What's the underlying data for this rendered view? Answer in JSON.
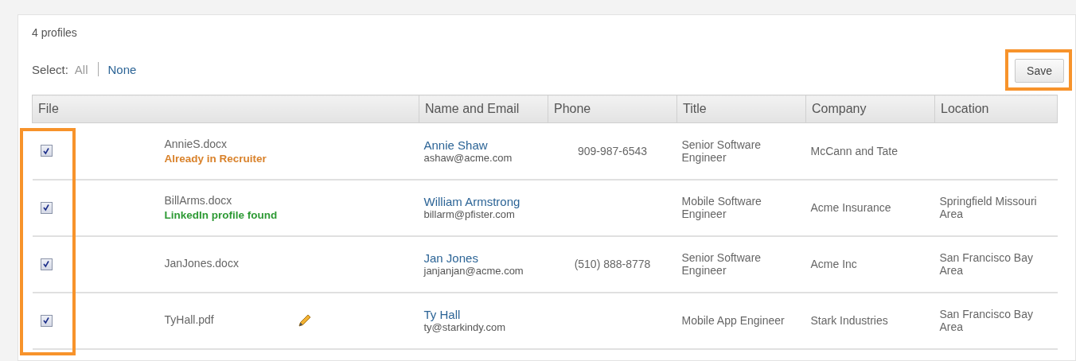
{
  "summary": "4 profiles",
  "select": {
    "label": "Select:",
    "options": [
      {
        "label": "All",
        "selected": true
      },
      {
        "label": "None",
        "selected": false
      }
    ]
  },
  "save_button": {
    "label": "Save",
    "highlighted": true
  },
  "table": {
    "checkbox_column_highlighted": true,
    "columns": [
      "File",
      "Name and Email",
      "Phone",
      "Title",
      "Company",
      "Location"
    ],
    "rows": [
      {
        "checked": true,
        "file": "AnnieS.docx",
        "status": {
          "text": "Already in Recruiter",
          "color": "#d9822b"
        },
        "editable": false,
        "name": "Annie Shaw",
        "email": "ashaw@acme.com",
        "phone": "909-987-6543",
        "title": "Senior Software Engineer",
        "company": "McCann and Tate"
      },
      {
        "checked": true,
        "file": "BillArms.docx",
        "status": {
          "text": "LinkedIn profile found",
          "color": "#2e9a35"
        },
        "editable": false,
        "name": "William Armstrong",
        "email": "billarm@pfister.com",
        "title": "Mobile Software Engineer",
        "company": "Acme Insurance",
        "location": "Springfield Missouri Area"
      },
      {
        "checked": true,
        "file": "JanJones.docx",
        "editable": false,
        "name": "Jan Jones",
        "email": "janjanjan@acme.com",
        "phone": "(510) 888-8778",
        "title": "Senior Software Engineer",
        "company": "Acme Inc",
        "location": "San Francisco Bay Area"
      },
      {
        "checked": true,
        "file": "TyHall.pdf",
        "editable": true,
        "name": "Ty Hall",
        "email": "ty@starkindy.com",
        "title": "Mobile App Engineer",
        "company": "Stark Industries",
        "location": "San Francisco Bay Area"
      }
    ]
  }
}
